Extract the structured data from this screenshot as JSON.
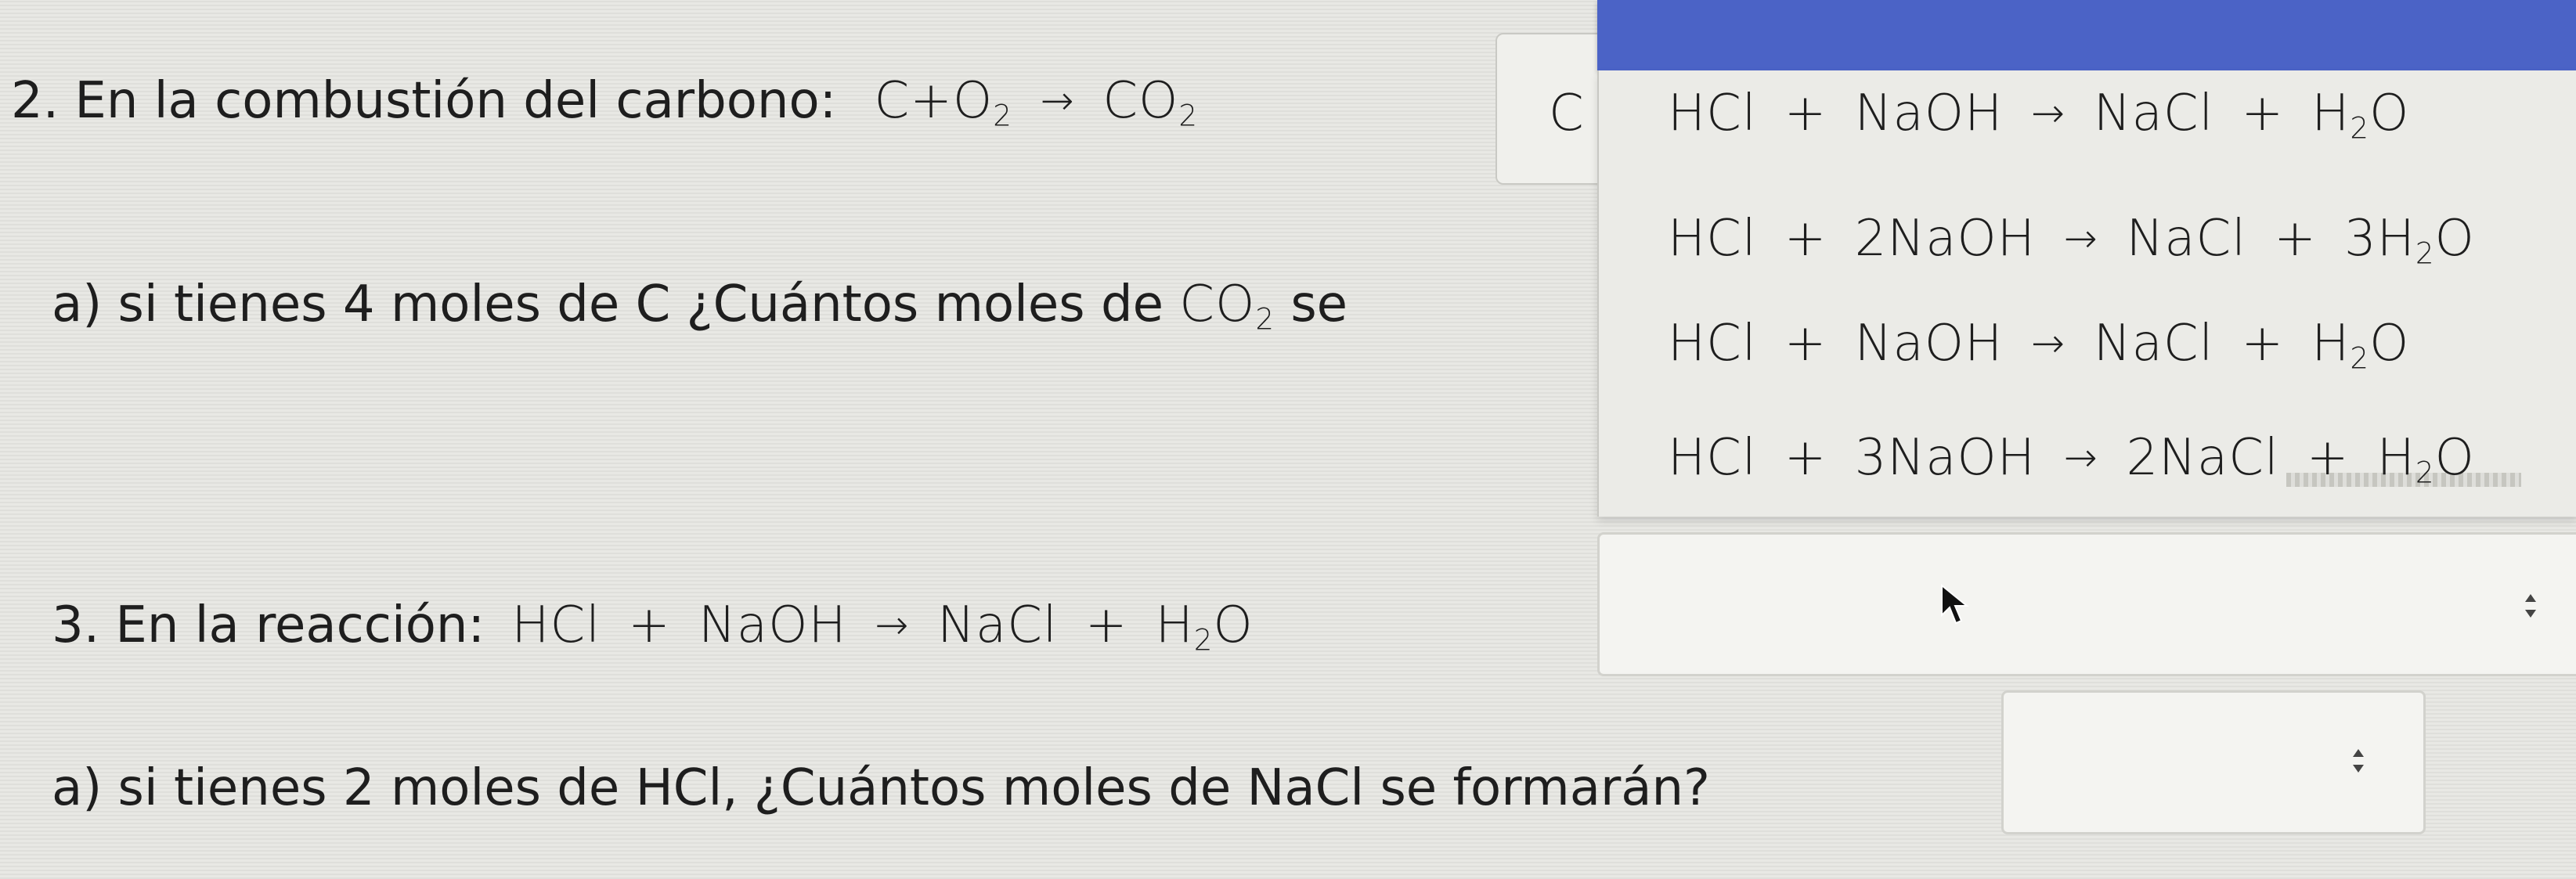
{
  "q2": {
    "text": "2. En la combustión del carbono:",
    "eq": {
      "a": "C",
      "plus": "+",
      "b": "O",
      "b_sub": "2",
      "arrow": "→",
      "c": "CO",
      "c_sub": "2"
    }
  },
  "q2a": {
    "text": "a)   si tienes 4 moles de C ¿Cuántos moles de",
    "formula": "CO",
    "formula_sub": "2",
    "trail": "se"
  },
  "partial_box_letter": "C",
  "dropdown": {
    "options": [
      {
        "a": "HCl",
        "b": "NaOH",
        "c": "NaCl",
        "d": "H",
        "d_sub": "2",
        "d_tail": "O",
        "plus": "+",
        "arrow": "→"
      },
      {
        "a": "HCl",
        "b": "2NaOH",
        "c": "NaCl",
        "d": "3H",
        "d_sub": "2",
        "d_tail": "O",
        "plus": "+",
        "arrow": "→"
      },
      {
        "a": "HCl",
        "b": "NaOH",
        "c": "NaCl",
        "d": "H",
        "d_sub": "2",
        "d_tail": "O",
        "plus": "+",
        "arrow": "→"
      },
      {
        "a": "HCl",
        "b": "3NaOH",
        "c": "2NaCl",
        "d": "H",
        "d_sub": "2",
        "d_tail": "O",
        "plus": "+",
        "arrow": "→"
      }
    ]
  },
  "q3": {
    "text": "3.   En la reacción:",
    "eq": {
      "a": "HCl",
      "plus": "+",
      "b": "NaOH",
      "arrow": "→",
      "c": "NaCl",
      "d": "H",
      "d_sub": "2",
      "d_tail": "O"
    }
  },
  "q3a": {
    "text": "a)   si tienes 2 moles de HCl, ¿Cuántos moles de NaCl se formarán?"
  },
  "icons": [
    "updown-arrows-icon",
    "mouse-cursor-icon"
  ]
}
